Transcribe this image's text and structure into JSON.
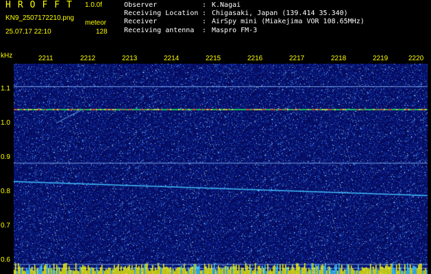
{
  "header": {
    "app_title": "HROFFT",
    "version": "1.0.0f",
    "filename": "KN9_2507172210.png",
    "mode": "meteor",
    "datetime": "25.07.17 22:10",
    "count": "128"
  },
  "info": [
    {
      "label": "Observer",
      "sep": ":",
      "value": "K.Nagai"
    },
    {
      "label": "Receiving Location",
      "sep": ":",
      "value": "Chigasaki, Japan (139.414 35.340)"
    },
    {
      "label": "Receiver",
      "sep": ":",
      "value": "AirSpy mini (Miakejima VOR 108.65MHz)"
    },
    {
      "label": "Receiving antenna",
      "sep": ":",
      "value": "Maspro FM-3"
    }
  ],
  "spectrogram": {
    "unit": "kHz",
    "time_ticks": [
      "2211",
      "2212",
      "2213",
      "2214",
      "2215",
      "2216",
      "2217",
      "2218",
      "2219",
      "2220"
    ],
    "freq_ticks": [
      "1.1",
      "1.0",
      "0.9",
      "0.8",
      "0.7",
      "0.6"
    ],
    "freq_range_khz": [
      0.59,
      1.14
    ],
    "horizontal_lines_khz": [
      1.08,
      1.02,
      0.88,
      0.615,
      0.605
    ],
    "drifting_line_khz": [
      0.832,
      0.795
    ],
    "colors": {
      "background": "#000000",
      "plot_bg": "#050a5a",
      "label": "#ffff00",
      "info_text": "#ffffff",
      "carrier": "#ff3030",
      "trace": "#40c0ff",
      "noise_bar": "#ffff00"
    }
  }
}
